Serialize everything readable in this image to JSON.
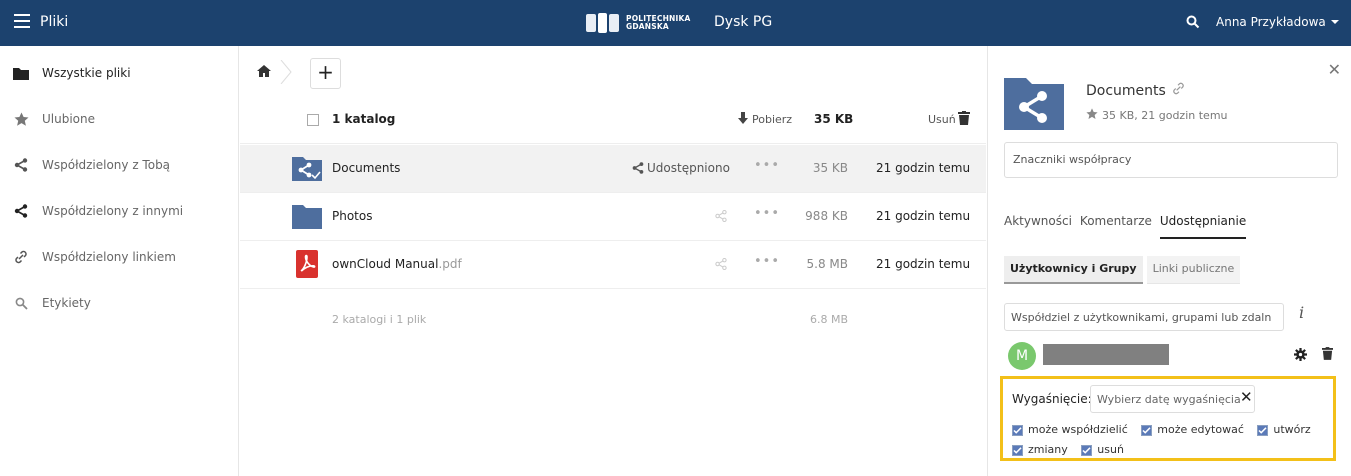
{
  "header": {
    "app_name": "Pliki",
    "logo_line1": "POLITECHNIKA",
    "logo_line2": "GDAŃSKA",
    "site_title": "Dysk PG",
    "user_name": "Anna Przykładowa",
    "bg_color": "#1c426e"
  },
  "sidebar": {
    "items": [
      {
        "label": "Wszystkie pliki",
        "icon": "folder-icon",
        "active": true
      },
      {
        "label": "Ulubione",
        "icon": "star-icon"
      },
      {
        "label": "Współdzielony z Tobą",
        "icon": "share-icon"
      },
      {
        "label": "Współdzielony z innymi",
        "icon": "share-icon"
      },
      {
        "label": "Współdzielony linkiem",
        "icon": "link-icon"
      },
      {
        "label": "Etykiety",
        "icon": "tag-search-icon"
      }
    ]
  },
  "filelist": {
    "header": {
      "count": "1 katalog",
      "download": "Pobierz",
      "size": "35 KB",
      "delete": "Usuń"
    },
    "files": [
      {
        "name": "Documents",
        "ext": "",
        "type": "shared-folder",
        "share_label": "Udostępniono",
        "size": "35 KB",
        "date": "21 godzin temu"
      },
      {
        "name": "Photos",
        "ext": "",
        "type": "folder",
        "share_label": "",
        "size": "988 KB",
        "date": "21 godzin temu"
      },
      {
        "name": "ownCloud Manual",
        "ext": ".pdf",
        "type": "pdf",
        "share_label": "",
        "size": "5.8 MB",
        "date": "21 godzin temu"
      }
    ],
    "summary": {
      "text": "2 katalogi i 1 plik",
      "size": "6.8 MB"
    }
  },
  "details": {
    "name": "Documents",
    "meta": "35 KB, 21 godzin temu",
    "tags_placeholder": "Znaczniki współpracy",
    "tabs": [
      "Aktywności",
      "Komentarze",
      "Udostępnianie"
    ],
    "active_tab": 2,
    "subtabs": [
      "Użytkownicy i Grupy",
      "Linki publiczne"
    ],
    "share_placeholder": "Współdziel z użytkownikami, grupami lub zdaln",
    "info_glyph": "i",
    "avatar_letter": "M",
    "expiration_label": "Wygaśnięcie:",
    "expiration_placeholder": "Wybierz datę wygaśnięcia",
    "permissions": [
      "może współdzielić",
      "może edytować",
      "utwórz",
      "zmiany",
      "usuń"
    ],
    "highlight_color": "#f3c019"
  }
}
